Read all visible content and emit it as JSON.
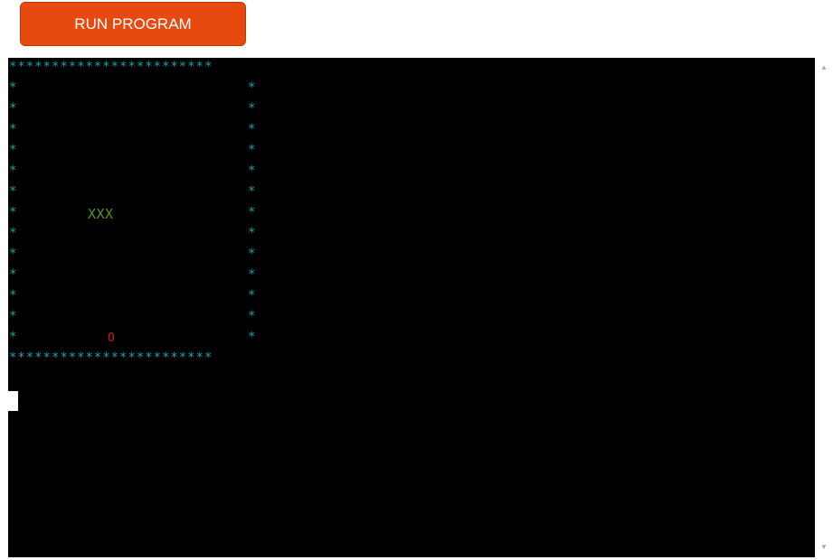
{
  "toolbar": {
    "run_label": "RUN PROGRAM"
  },
  "console": {
    "border_top": "************************",
    "border_bottom": "************************",
    "wall_char": "*",
    "snake": "XXX",
    "food": "O"
  },
  "colors": {
    "button": "#e8490f",
    "border": "#1aa3a3",
    "snake": "#4d9a1f",
    "food": "#cc1a1a",
    "background": "#000000"
  },
  "icons": {
    "scroll_up": "triangle-up-icon",
    "scroll_down": "triangle-down-icon"
  }
}
